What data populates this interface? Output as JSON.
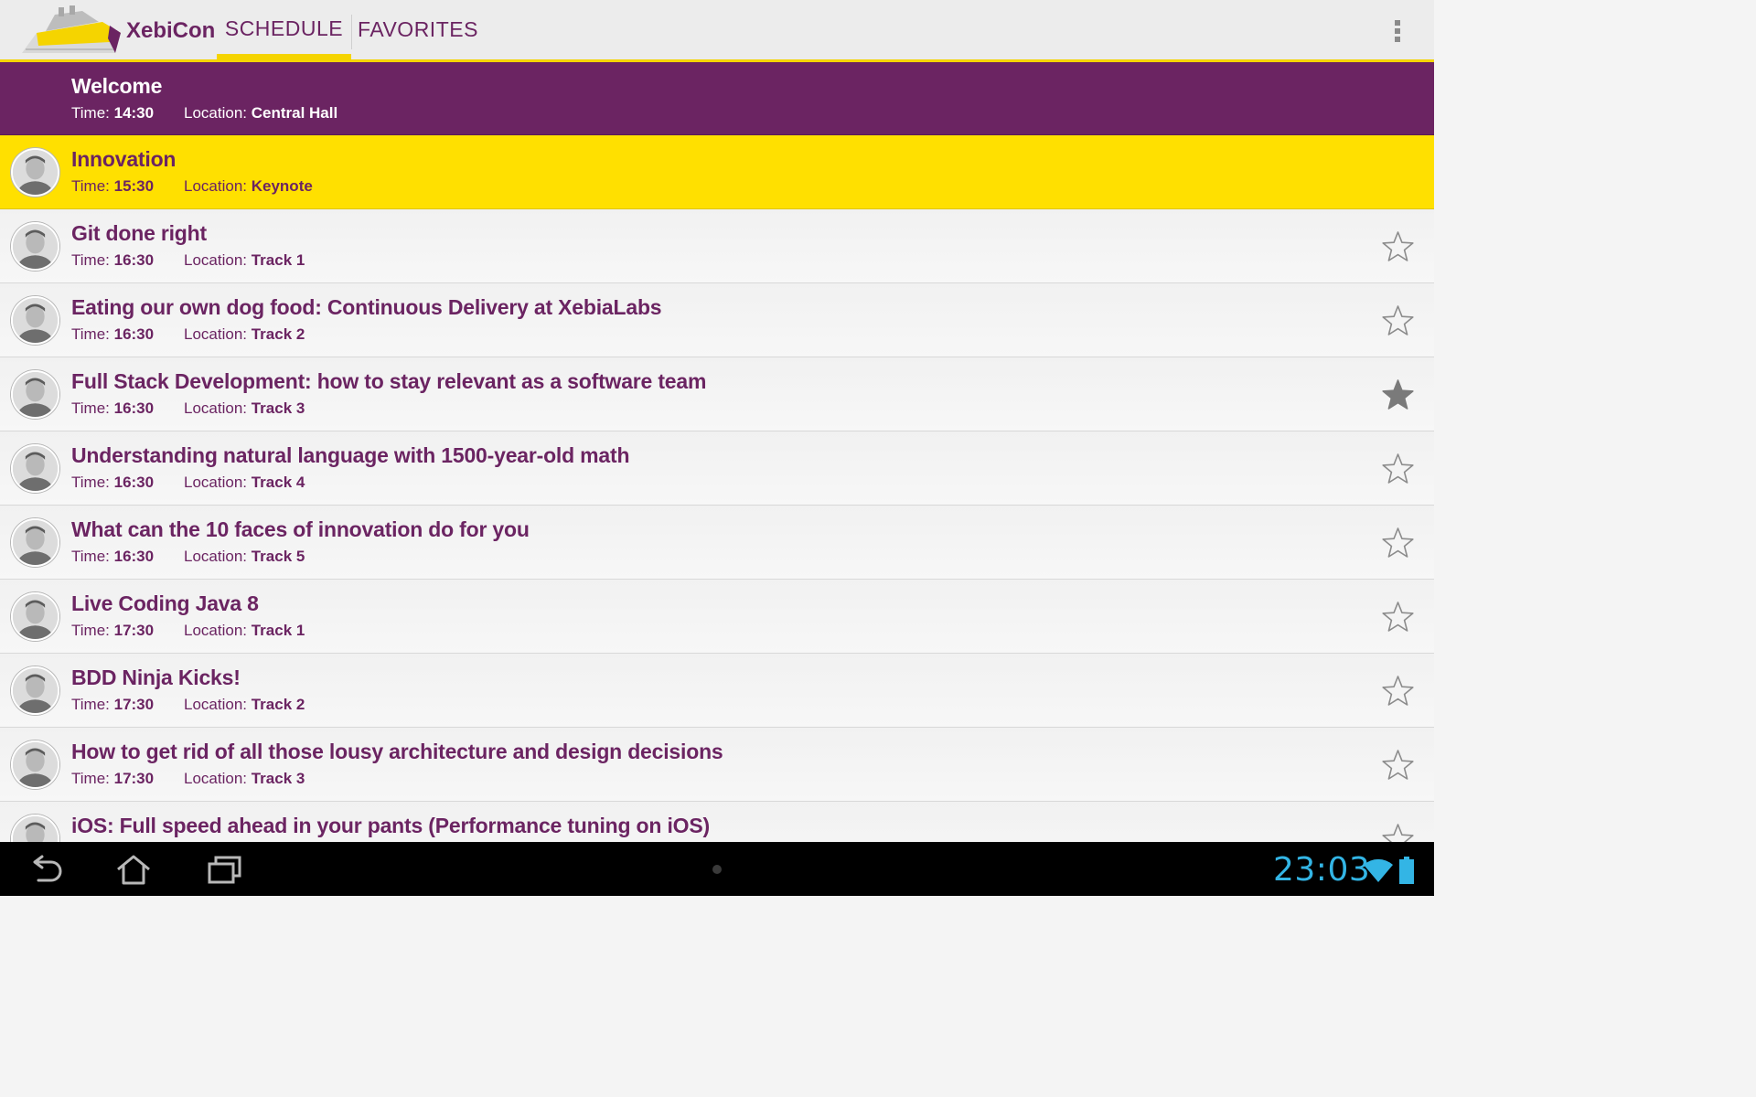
{
  "app": {
    "title": "XebiCon",
    "tabs": {
      "schedule": "SCHEDULE",
      "favorites": "FAVORITES"
    },
    "labels": {
      "time": "Time:",
      "location": "Location:"
    }
  },
  "sessions": [
    {
      "title": "Welcome",
      "time": "14:30",
      "location": "Central Hall",
      "style": "purple",
      "avatar": false,
      "star": "none"
    },
    {
      "title": "Innovation",
      "time": "15:30",
      "location": "Keynote",
      "style": "yellow",
      "avatar": true,
      "star": "none"
    },
    {
      "title": "Git done right",
      "time": "16:30",
      "location": "Track 1",
      "style": "normal",
      "avatar": true,
      "star": "outline"
    },
    {
      "title": "Eating our own dog food: Continuous Delivery at XebiaLabs",
      "time": "16:30",
      "location": "Track 2",
      "style": "normal",
      "avatar": true,
      "star": "outline"
    },
    {
      "title": "Full Stack Development: how to stay relevant as a software team",
      "time": "16:30",
      "location": "Track 3",
      "style": "normal",
      "avatar": true,
      "star": "filled"
    },
    {
      "title": "Understanding natural language with 1500-year-old math",
      "time": "16:30",
      "location": "Track 4",
      "style": "normal",
      "avatar": true,
      "star": "outline"
    },
    {
      "title": "What can the 10 faces of innovation do for you",
      "time": "16:30",
      "location": "Track 5",
      "style": "normal",
      "avatar": true,
      "star": "outline"
    },
    {
      "title": "Live Coding Java 8",
      "time": "17:30",
      "location": "Track 1",
      "style": "normal",
      "avatar": true,
      "star": "outline"
    },
    {
      "title": "BDD Ninja Kicks!",
      "time": "17:30",
      "location": "Track 2",
      "style": "normal",
      "avatar": true,
      "star": "outline"
    },
    {
      "title": "How to get rid of all those lousy architecture and design decisions",
      "time": "17:30",
      "location": "Track 3",
      "style": "normal",
      "avatar": true,
      "star": "outline"
    },
    {
      "title": "iOS: Full speed ahead in your pants (Performance tuning on iOS)",
      "time": "",
      "location": "",
      "style": "normal",
      "avatar": true,
      "star": "outline"
    }
  ],
  "status_bar": {
    "clock": "23:03"
  },
  "icons": {
    "overflow": "overflow-menu-icon",
    "star_outline": "star-outline-icon",
    "star_filled": "star-filled-icon",
    "back": "back-icon",
    "home": "home-icon",
    "recents": "recent-apps-icon",
    "wifi": "wifi-icon",
    "battery": "battery-icon"
  },
  "colors": {
    "brand_purple": "#6b2462",
    "brand_yellow": "#ffe000",
    "clock_blue": "#33b5e5"
  }
}
